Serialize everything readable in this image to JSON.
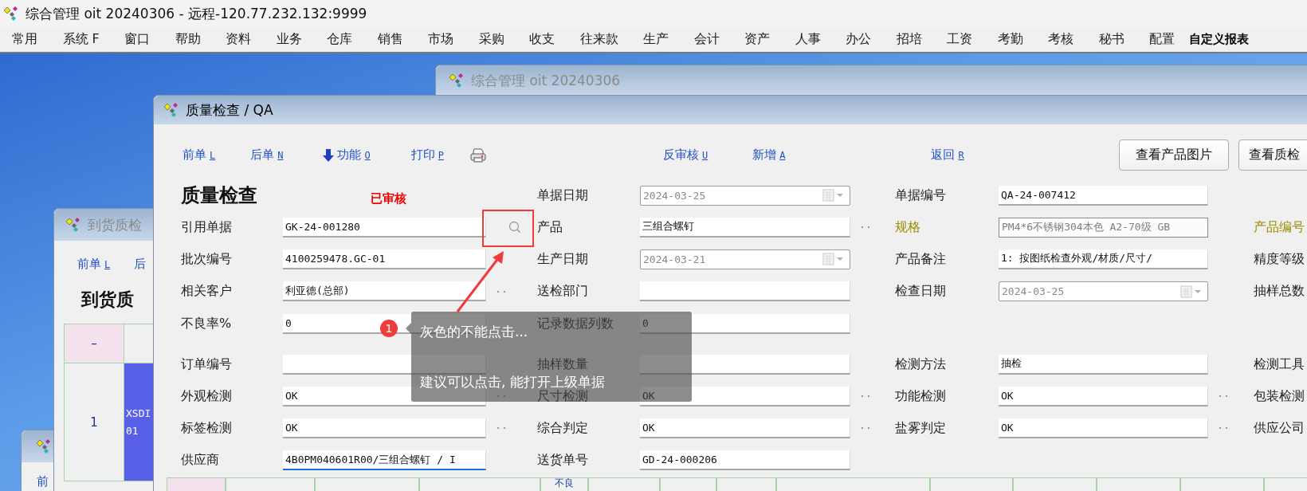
{
  "app_title": "综合管理 oit 20240306 - 远程-120.77.232.132:9999",
  "menu": [
    {
      "label": "常用",
      "emphasized": false
    },
    {
      "label": "系统 F",
      "emphasized": false
    },
    {
      "label": "窗口",
      "emphasized": false
    },
    {
      "label": "帮助",
      "emphasized": false
    },
    {
      "label": "资料",
      "emphasized": false
    },
    {
      "label": "业务",
      "emphasized": false
    },
    {
      "label": "仓库",
      "emphasized": false
    },
    {
      "label": "销售",
      "emphasized": false
    },
    {
      "label": "市场",
      "emphasized": false
    },
    {
      "label": "采购",
      "emphasized": false
    },
    {
      "label": "收支",
      "emphasized": false
    },
    {
      "label": "往来款",
      "emphasized": false
    },
    {
      "label": "生产",
      "emphasized": false
    },
    {
      "label": "会计",
      "emphasized": false
    },
    {
      "label": "资产",
      "emphasized": false
    },
    {
      "label": "人事",
      "emphasized": false
    },
    {
      "label": "办公",
      "emphasized": false
    },
    {
      "label": "招培",
      "emphasized": false
    },
    {
      "label": "工资",
      "emphasized": false
    },
    {
      "label": "考勤",
      "emphasized": false
    },
    {
      "label": "考核",
      "emphasized": false
    },
    {
      "label": "秘书",
      "emphasized": false
    },
    {
      "label": "配置",
      "emphasized": false
    },
    {
      "label": "自定义报表",
      "emphasized": true
    }
  ],
  "back_window": {
    "title": "综合管理 oit 20240306"
  },
  "small_window": {
    "toolbar": [
      {
        "label": "前"
      }
    ]
  },
  "left_window": {
    "title": "到货质检",
    "toolbar": [
      {
        "label": "前单",
        "key": "L"
      },
      {
        "label": "后"
      }
    ],
    "heading": "到货质",
    "table": {
      "columns": [
        "–"
      ],
      "rows": [
        {
          "number": "1",
          "selected": true,
          "cells": [
            "XSDI 01"
          ]
        }
      ]
    }
  },
  "main_window": {
    "title": "质量检查 / QA",
    "toolbar": [
      {
        "kind": "link",
        "label": "前单",
        "key": "L"
      },
      {
        "kind": "link",
        "label": "后单",
        "key": "N"
      },
      {
        "kind": "arrow_link",
        "label": "功能",
        "key": "O"
      },
      {
        "kind": "link",
        "label": "打印",
        "key": "P"
      },
      {
        "kind": "printer"
      },
      {
        "kind": "link",
        "label": "反审核",
        "key": "U"
      },
      {
        "kind": "link",
        "label": "新增",
        "key": "A"
      },
      {
        "kind": "link",
        "label": "返回",
        "key": "R"
      }
    ],
    "buttons": [
      "查看产品图片",
      "查看质检"
    ],
    "rows": [
      [
        {
          "kind": "heading",
          "text": "质量检查",
          "status": "已审核"
        },
        {
          "kind": "date",
          "label": "单据日期",
          "highlighted": false,
          "value": "2024-03-25",
          "lookup": false,
          "focused": false
        },
        {
          "kind": "text",
          "label": "单据编号",
          "highlighted": false,
          "value": "QA-24-007412",
          "lookup": false,
          "focused": false
        },
        null
      ],
      [
        {
          "kind": "search",
          "label": "引用单据",
          "highlighted": false,
          "value": "GK-24-001280",
          "lookup": false,
          "focused": false
        },
        {
          "kind": "text",
          "label": "产品",
          "highlighted": false,
          "value": "三组合螺钉",
          "lookup": true,
          "focused": false
        },
        {
          "kind": "readonly",
          "label": "规格",
          "highlighted": true,
          "value": "PM4*6不锈钢304本色 A2-70级 GB",
          "lookup": false,
          "focused": false
        },
        {
          "kind": "label_only",
          "label": "产品编号",
          "highlighted": true
        }
      ],
      [
        {
          "kind": "text",
          "label": "批次编号",
          "highlighted": false,
          "value": "4100259478.GC-01",
          "lookup": false,
          "focused": false
        },
        {
          "kind": "date",
          "label": "生产日期",
          "highlighted": false,
          "value": "2024-03-21",
          "lookup": false,
          "focused": false
        },
        {
          "kind": "text",
          "label": "产品备注",
          "highlighted": false,
          "value": "1: 按图纸检查外观/材质/尺寸/",
          "lookup": false,
          "focused": false
        },
        {
          "kind": "label_only",
          "label": "精度等级",
          "highlighted": false
        }
      ],
      [
        {
          "kind": "text",
          "label": "相关客户",
          "highlighted": false,
          "value": "利亚德(总部)",
          "lookup": true,
          "focused": false
        },
        {
          "kind": "text",
          "label": "送检部门",
          "highlighted": false,
          "lookup": false,
          "focused": false
        },
        {
          "kind": "date",
          "label": "检查日期",
          "highlighted": false,
          "value": "2024-03-25",
          "lookup": false,
          "focused": false
        },
        {
          "kind": "label_only",
          "label": "抽样总数",
          "highlighted": false
        }
      ],
      [
        {
          "kind": "text",
          "label": "不良率%",
          "highlighted": false,
          "value": "0",
          "lookup": false,
          "focused": false
        },
        {
          "kind": "text",
          "label": "记录数据列数",
          "highlighted": false,
          "value": "0",
          "lookup": false,
          "focused": false
        },
        null,
        null
      ],
      [
        {
          "kind": "text",
          "label": "订单编号",
          "highlighted": false,
          "lookup": false,
          "focused": false
        },
        {
          "kind": "text",
          "label": "抽样数量",
          "highlighted": false,
          "lookup": false,
          "focused": false
        },
        {
          "kind": "text",
          "label": "检测方法",
          "highlighted": false,
          "value": "抽检",
          "lookup": false,
          "focused": false
        },
        {
          "kind": "label_only",
          "label": "检测工具",
          "highlighted": false
        }
      ],
      [
        {
          "kind": "text",
          "label": "外观检测",
          "highlighted": false,
          "value": "OK",
          "lookup": true,
          "focused": false
        },
        {
          "kind": "text",
          "label": "尺寸检测",
          "highlighted": false,
          "value": "OK",
          "lookup": true,
          "focused": false
        },
        {
          "kind": "text",
          "label": "功能检测",
          "highlighted": false,
          "value": "OK",
          "lookup": true,
          "focused": false
        },
        {
          "kind": "label_only",
          "label": "包装检测",
          "highlighted": false
        }
      ],
      [
        {
          "kind": "text",
          "label": "标签检测",
          "highlighted": false,
          "value": "OK",
          "lookup": true,
          "focused": false
        },
        {
          "kind": "text",
          "label": "综合判定",
          "highlighted": false,
          "value": "OK",
          "lookup": true,
          "focused": false
        },
        {
          "kind": "text",
          "label": "盐雾判定",
          "highlighted": false,
          "value": "OK",
          "lookup": true,
          "focused": false
        },
        {
          "kind": "label_only",
          "label": "供应公司",
          "highlighted": false
        }
      ],
      [
        {
          "kind": "text",
          "label": "供应商",
          "highlighted": false,
          "value": "4B0PM040601R00/三组合螺钉 / I",
          "lookup": false,
          "focused": true
        },
        {
          "kind": "text",
          "label": "送货单号",
          "highlighted": false,
          "value": "GD-24-000206",
          "lookup": false,
          "focused": false
        },
        null,
        null
      ]
    ],
    "grid_header": [
      {
        "label": "不良"
      }
    ]
  },
  "annotation": {
    "number": "1",
    "lines": [
      "灰色的不能点击...",
      "建议可以点击, 能打开上级单据"
    ]
  }
}
